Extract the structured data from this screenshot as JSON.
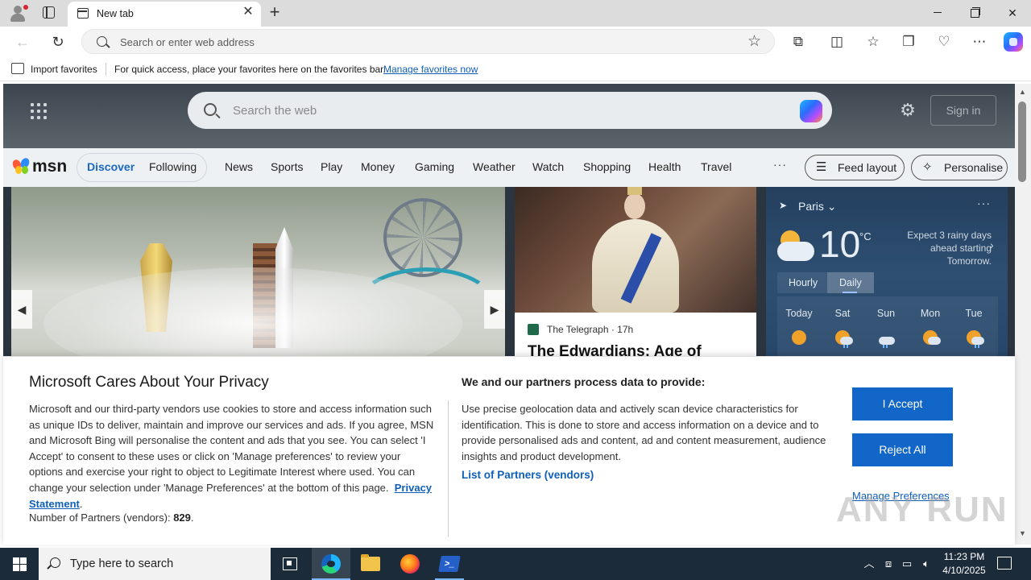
{
  "browser": {
    "tab_title": "New tab",
    "address_placeholder": "Search or enter web address",
    "favorites_bar": {
      "import_label": "Import favorites",
      "message": "For quick access, place your favorites here on the favorites bar.",
      "manage_link": "Manage favorites now"
    }
  },
  "msn": {
    "search_placeholder": "Search the web",
    "sign_in": "Sign in",
    "logo_text": "msn",
    "nav": {
      "discover": "Discover",
      "following": "Following",
      "items": [
        "News",
        "Sports",
        "Play",
        "Money",
        "Gaming",
        "Weather",
        "Watch",
        "Shopping",
        "Health",
        "Travel"
      ],
      "more": "···",
      "feed_layout": "Feed layout",
      "personalise": "Personalise"
    },
    "story": {
      "source": "The Telegraph",
      "age": "· 17h",
      "headline": "The Edwardians: Age of"
    },
    "weather": {
      "location": "Paris",
      "temperature": "10",
      "unit": "°C",
      "forecast_text": "Expect 3 rainy days ahead starting Tomorrow.",
      "tab_hourly": "Hourly",
      "tab_daily": "Daily",
      "days": [
        "Today",
        "Sat",
        "Sun",
        "Mon",
        "Tue"
      ]
    }
  },
  "privacy": {
    "title": "Microsoft Cares About Your Privacy",
    "body": "Microsoft and our third-party vendors use cookies to store and access information such as unique IDs to deliver, maintain and improve our services and ads. If you agree, MSN and Microsoft Bing will personalise the content and ads that you see. You can select 'I Accept' to consent to these uses or click on 'Manage preferences' to review your options and exercise your right to object to Legitimate Interest where used.  You can change your selection under 'Manage Preferences' at the bottom of this page.",
    "privacy_link": "Privacy Statement",
    "partners_label": "Number of Partners (vendors):",
    "partners_count": "829",
    "sub_title": "We and our partners process data to provide:",
    "sub_body": "Use precise geolocation data and actively scan device characteristics for identification. This is done to store and access information on a device and to provide personalised ads and content, ad and content measurement, audience insights and product development.",
    "vendors_link": "List of Partners (vendors)",
    "accept": "I Accept",
    "reject": "Reject All",
    "manage": "Manage Preferences"
  },
  "watermark": "ANY RUN",
  "taskbar": {
    "search_placeholder": "Type here to search",
    "time": "11:23 PM",
    "date": "4/10/2025"
  },
  "colors": {
    "accent": "#1166c8",
    "link": "#0f5fb8",
    "taskbar": "#1c2b3a"
  }
}
